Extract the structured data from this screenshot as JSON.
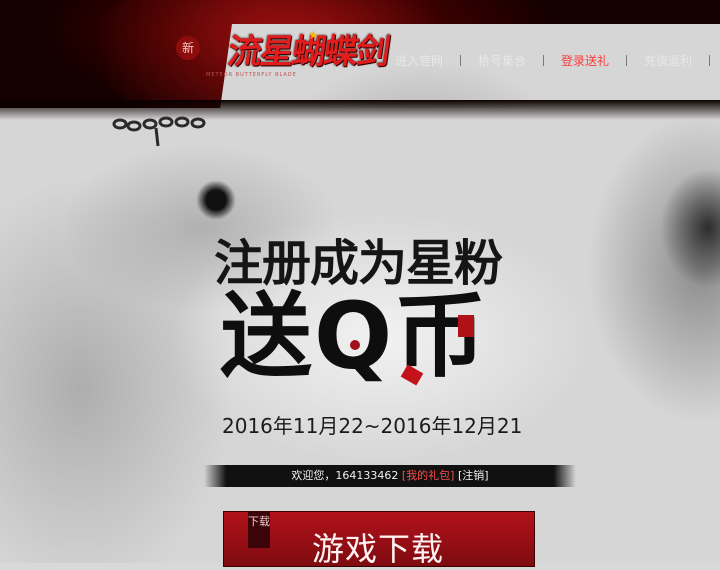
{
  "header": {
    "logo_badge": "新",
    "logo_main": "流星蝴蝶剑",
    "logo_sub": "METEOR BUTTERFLY BLADE",
    "nav": [
      {
        "label": "进入官网",
        "active": false
      },
      {
        "label": "拾号集合",
        "active": false
      },
      {
        "label": "登录送礼",
        "active": true
      },
      {
        "label": "充值返利",
        "active": false
      }
    ]
  },
  "promo": {
    "headline_line1": "注册成为星粉",
    "headline_line2": "送Q币",
    "date_range": "2016年11月22~2016年12月21"
  },
  "user_bar": {
    "welcome_prefix": "欢迎您，164133462 ",
    "my_gifts_link": "[我的礼包]",
    "logout_link": "[注销]"
  },
  "download": {
    "tag": "下载",
    "label": "游戏下载"
  },
  "colors": {
    "accent_red": "#c4121a",
    "nav_active": "#ff3a3a",
    "header_bg": "#2a0000"
  }
}
